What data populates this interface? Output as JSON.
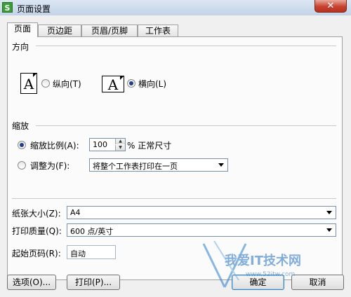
{
  "window": {
    "title": "页面设置",
    "app_icon_letter": "S",
    "close_glyph": "✕"
  },
  "tabs": [
    {
      "label": "页面",
      "active": true
    },
    {
      "label": "页边距",
      "active": false
    },
    {
      "label": "页眉/页脚",
      "active": false
    },
    {
      "label": "工作表",
      "active": false
    }
  ],
  "orientation": {
    "group_label": "方向",
    "icon_letter": "A",
    "portrait_label": "纵向(T)",
    "landscape_label": "横向(L)",
    "selected": "landscape"
  },
  "scaling": {
    "group_label": "缩放",
    "scale_label": "缩放比例(A):",
    "scale_value": "100",
    "spin_up": "▲",
    "spin_down": "▼",
    "scale_unit": "% 正常尺寸",
    "fit_label": "调整为(F):",
    "fit_option": "将整个工作表打印在一页",
    "selected": "scale"
  },
  "paper": {
    "size_label": "纸张大小(Z):",
    "size_value": "A4",
    "quality_label": "打印质量(Q):",
    "quality_value": "600 点/英寸",
    "first_page_label": "起始页码(R):",
    "first_page_value": "自动"
  },
  "buttons": {
    "options": "选项(O)...",
    "print": "打印(P)...",
    "ok": "确定",
    "cancel": "取消"
  },
  "watermark": {
    "text": "我爱IT技术网",
    "url": "www.52itw.com"
  }
}
